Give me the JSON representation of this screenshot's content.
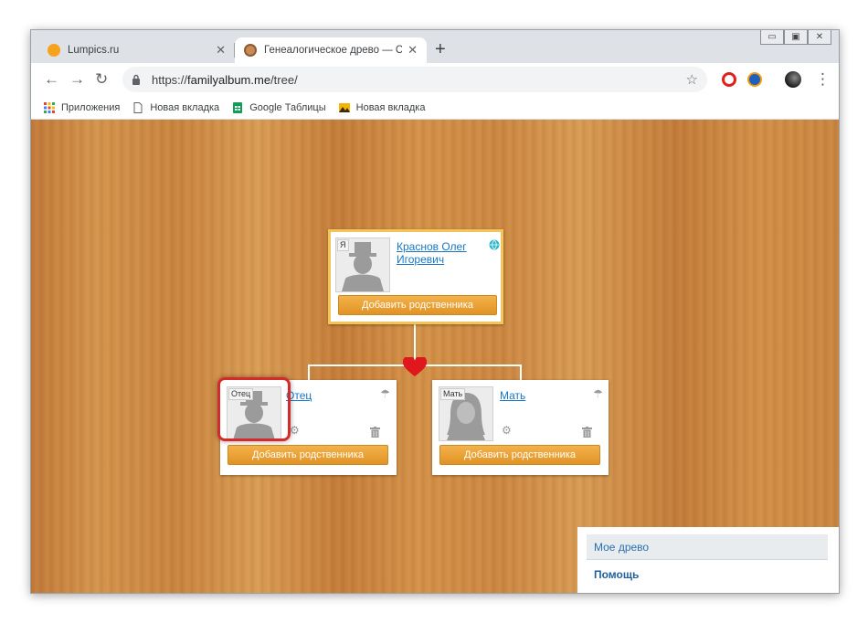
{
  "tabs": [
    {
      "title": "Lumpics.ru",
      "favicon": "lumpics-orange-circle-icon",
      "close": "✕"
    },
    {
      "title": "Генеалогическое древо — Сем",
      "favicon": "familyalbum-icon",
      "close": "✕"
    }
  ],
  "new_tab": "+",
  "window_controls": {
    "minimize": "▭",
    "maximize": "▣",
    "close": "✕"
  },
  "toolbar": {
    "back": "←",
    "forward": "→",
    "reload": "↻",
    "url_scheme": "https://",
    "url_host": "familyalbum.me",
    "url_path": "/tree/",
    "bookmark_star": "☆",
    "menu": "⋮"
  },
  "bookmarks": [
    {
      "label": "Приложения",
      "icon": "apps-grid-icon"
    },
    {
      "label": "Новая вкладка",
      "icon": "page-icon"
    },
    {
      "label": "Google Таблицы",
      "icon": "google-sheets-icon"
    },
    {
      "label": "Новая вкладка",
      "icon": "image-bookmark-icon"
    }
  ],
  "tree": {
    "me": {
      "tag": "Я",
      "name_line1": "Краснов Олег",
      "name_line2": "Игоревич",
      "add_label": "Добавить родственника"
    },
    "father": {
      "tag": "Отец",
      "name": "Отец",
      "add_label": "Добавить родственника"
    },
    "mother": {
      "tag": "Мать",
      "name": "Мать",
      "add_label": "Добавить родственника"
    }
  },
  "sidebar": {
    "items": [
      {
        "label": "Мое древо"
      },
      {
        "label": "Помощь"
      }
    ]
  },
  "colors": {
    "accent_button": "#e8a035",
    "link": "#1a76c4",
    "heart": "#e0171c",
    "highlight_border": "#d62a2a",
    "main_card_border": "#f1c55a"
  }
}
